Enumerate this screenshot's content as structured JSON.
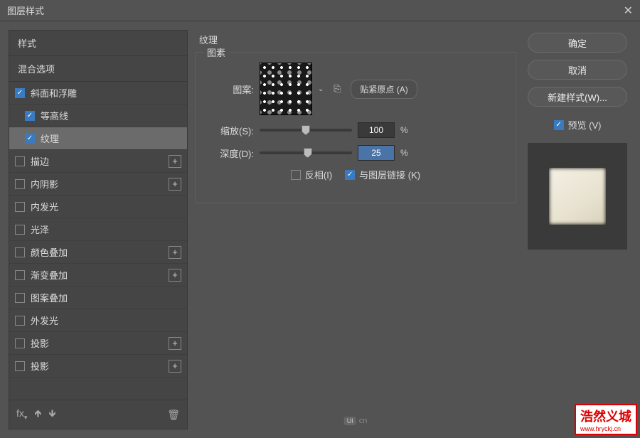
{
  "dialog": {
    "title": "图层样式"
  },
  "left": {
    "styles_header": "样式",
    "blend_header": "混合选项",
    "effects": [
      {
        "label": "斜面和浮雕",
        "checked": true,
        "plus": false,
        "indent": false,
        "selected": false
      },
      {
        "label": "等高线",
        "checked": true,
        "plus": false,
        "indent": true,
        "selected": false
      },
      {
        "label": "纹理",
        "checked": true,
        "plus": false,
        "indent": true,
        "selected": true
      },
      {
        "label": "描边",
        "checked": false,
        "plus": true,
        "indent": false,
        "selected": false
      },
      {
        "label": "内阴影",
        "checked": false,
        "plus": true,
        "indent": false,
        "selected": false
      },
      {
        "label": "内发光",
        "checked": false,
        "plus": false,
        "indent": false,
        "selected": false
      },
      {
        "label": "光泽",
        "checked": false,
        "plus": false,
        "indent": false,
        "selected": false
      },
      {
        "label": "颜色叠加",
        "checked": false,
        "plus": true,
        "indent": false,
        "selected": false
      },
      {
        "label": "渐变叠加",
        "checked": false,
        "plus": true,
        "indent": false,
        "selected": false
      },
      {
        "label": "图案叠加",
        "checked": false,
        "plus": false,
        "indent": false,
        "selected": false
      },
      {
        "label": "外发光",
        "checked": false,
        "plus": false,
        "indent": false,
        "selected": false
      },
      {
        "label": "投影",
        "checked": false,
        "plus": true,
        "indent": false,
        "selected": false
      },
      {
        "label": "投影",
        "checked": false,
        "plus": true,
        "indent": false,
        "selected": false
      }
    ],
    "fx_label": "fx"
  },
  "center": {
    "title": "纹理",
    "panel_legend": "图素",
    "pattern_label": "图案:",
    "snap_button": "贴紧原点 (A)",
    "scale_label": "缩放(S):",
    "scale_value": "100",
    "scale_pct": 50,
    "depth_label": "深度(D):",
    "depth_value": "25",
    "depth_pct": 52,
    "unit": "%",
    "invert_label": "反相(I)",
    "invert_checked": false,
    "link_label": "与图层链接 (K)",
    "link_checked": true,
    "logo": "cn"
  },
  "right": {
    "ok": "确定",
    "cancel": "取消",
    "new_style": "新建样式(W)...",
    "preview_label": "预览 (V)",
    "preview_checked": true
  },
  "watermark": {
    "main": "浩然义城",
    "sub": "www.hryckj.cn"
  }
}
